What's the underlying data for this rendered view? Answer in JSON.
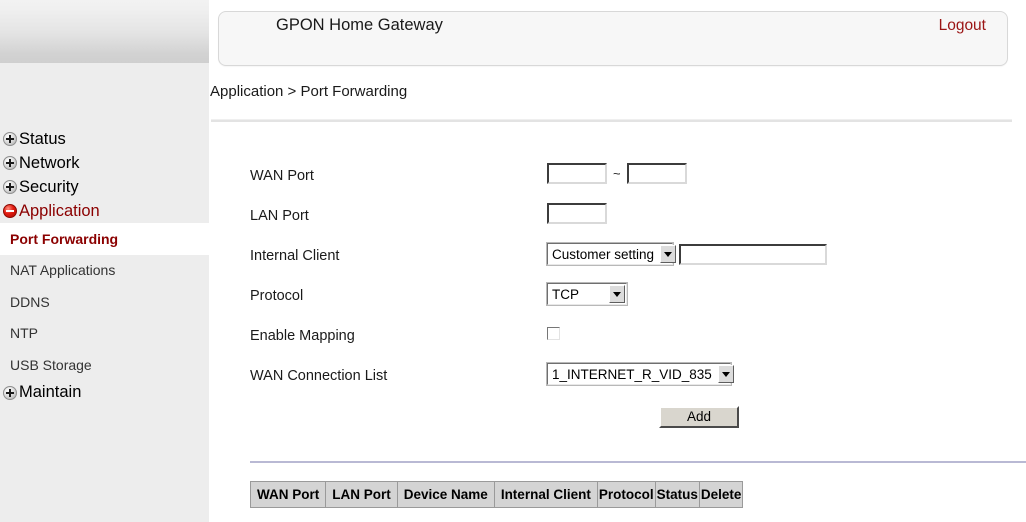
{
  "sidebar": {
    "top_items": [
      {
        "label": "Status",
        "icon": "plus-circle-icon",
        "state": "collapsed"
      },
      {
        "label": "Network",
        "icon": "plus-circle-icon",
        "state": "collapsed"
      },
      {
        "label": "Security",
        "icon": "plus-circle-icon",
        "state": "collapsed"
      },
      {
        "label": "Application",
        "icon": "minus-circle-icon",
        "state": "expanded"
      }
    ],
    "sub_items": [
      {
        "label": "Port Forwarding",
        "active": true
      },
      {
        "label": "NAT Applications",
        "active": false
      },
      {
        "label": "DDNS",
        "active": false
      },
      {
        "label": "NTP",
        "active": false
      },
      {
        "label": "USB Storage",
        "active": false
      }
    ],
    "bottom_items": [
      {
        "label": "Maintain",
        "icon": "plus-circle-icon",
        "state": "collapsed"
      }
    ]
  },
  "header": {
    "app_title": "GPON Home Gateway",
    "logout_label": "Logout"
  },
  "breadcrumb": "Application > Port Forwarding",
  "form": {
    "rows": [
      {
        "label": "WAN Port"
      },
      {
        "label": "LAN Port"
      },
      {
        "label": "Internal Client"
      },
      {
        "label": "Protocol"
      },
      {
        "label": "Enable Mapping"
      },
      {
        "label": "WAN Connection List"
      }
    ],
    "wan_port_start_value": "",
    "wan_port_start_placeholder": "",
    "wan_port_range_separator": "~",
    "wan_port_end_value": "",
    "wan_port_end_placeholder": "",
    "lan_port_value": "",
    "lan_port_placeholder": "",
    "internal_client_selected": "Customer setting",
    "internal_client_value": "",
    "internal_client_placeholder": "",
    "protocol_selected": "TCP",
    "enable_mapping_checked": false,
    "wan_connection_selected": "1_INTERNET_R_VID_835",
    "add_label": "Add"
  },
  "table": {
    "columns": [
      "WAN Port",
      "LAN Port",
      "Device Name",
      "Internal Client",
      "Protocol",
      "Status",
      "Delete"
    ],
    "rows": []
  },
  "colors": {
    "accent_red": "#8B0000",
    "logout_red": "#9b1515",
    "sidebar_bg": "#ededed",
    "table_header_bg": "#d4d4d4",
    "divider_lavender": "#b9b9d4"
  }
}
